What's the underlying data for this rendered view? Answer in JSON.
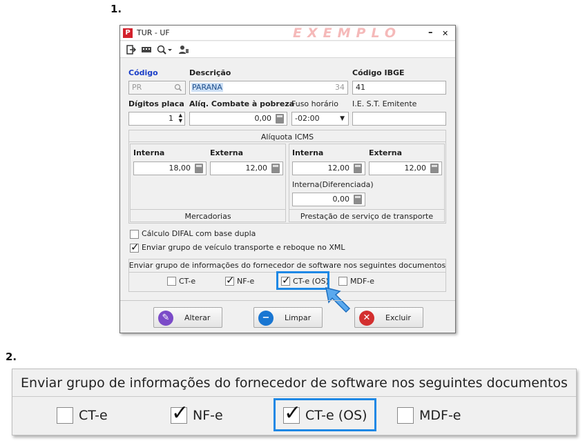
{
  "steps": [
    "1.",
    "2."
  ],
  "window": {
    "title": "TUR - UF",
    "watermark": "EXEMPLO",
    "minimize": "–",
    "close": "✕",
    "toolbar_icons": [
      "exit-icon",
      "keyboard-icon",
      "search-icon",
      "user-icon"
    ],
    "dropdown_arrow": "▾"
  },
  "form": {
    "codigo_label": "Código",
    "codigo_value": "PR",
    "descricao_label": "Descrição",
    "descricao_value": "PARANA",
    "descricao_count": "34",
    "ibge_label": "Código IBGE",
    "ibge_value": "41",
    "digitos_label": "Dígitos placa",
    "digitos_value": "1",
    "aliq_pobreza_label": "Alíq. Combate à pobreza",
    "aliq_pobreza_value": "0,00",
    "fuso_label": "Fuso horário",
    "fuso_value": "-02:00",
    "ie_label": "I.E. S.T.  Emitente",
    "ie_value": ""
  },
  "icms": {
    "title": "Alíquota ICMS",
    "interna_label": "Interna",
    "externa_label": "Externa",
    "merc_interna": "18,00",
    "merc_externa": "12,00",
    "merc_caption": "Mercadorias",
    "transp_interna": "12,00",
    "transp_externa": "12,00",
    "diferenciada_label": "Interna(Diferenciada)",
    "diferenciada_value": "0,00",
    "transp_caption": "Prestação de serviço de transporte"
  },
  "options": {
    "difal_label": "Cálculo DIFAL com base dupla",
    "difal_checked": false,
    "veiculo_label": "Enviar grupo de veículo transporte e reboque no XML",
    "veiculo_checked": true
  },
  "software_group": {
    "title": "Enviar grupo de informações do fornecedor de software nos seguintes documentos",
    "items": [
      {
        "label": "CT-e",
        "checked": false
      },
      {
        "label": "NF-e",
        "checked": true
      },
      {
        "label": "CT-e (OS)",
        "checked": true
      },
      {
        "label": "MDF-e",
        "checked": false
      }
    ]
  },
  "buttons": {
    "alterar": "Alterar",
    "limpar": "Limpar",
    "excluir": "Excluir"
  },
  "colors": {
    "highlight": "#1e88e5",
    "alterar_icon": "#7b4bc8",
    "limpar_icon": "#1976d2",
    "excluir_icon": "#d32f2f"
  }
}
